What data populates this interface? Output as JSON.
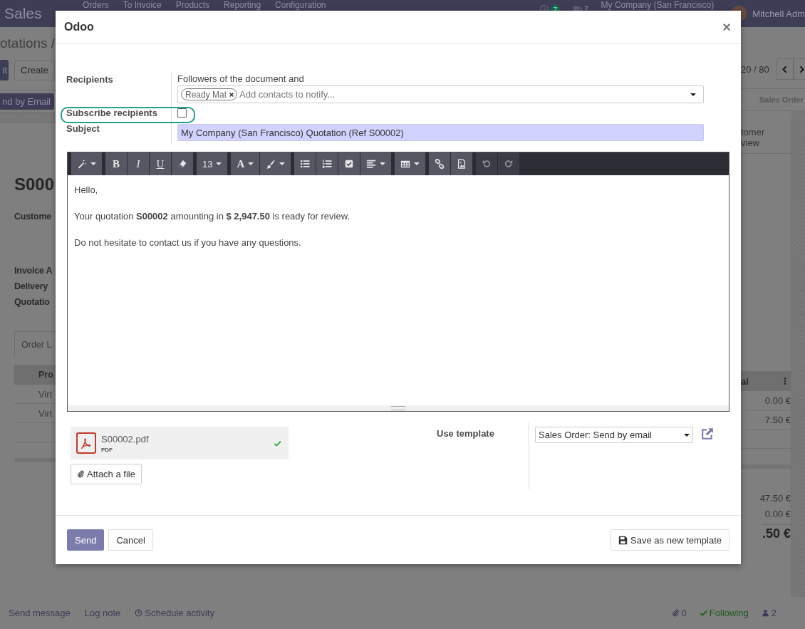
{
  "top_bar": {
    "app": "Sales",
    "menu": [
      "Orders",
      "To Invoice",
      "Products",
      "Reporting",
      "Configuration"
    ],
    "activity_count": "7",
    "message_count": "7",
    "company": "My Company (San Francisco)",
    "user": "Mitchell Adm"
  },
  "background": {
    "breadcrumb": "otations /",
    "buttons": [
      {
        "label": "it",
        "kind": "primary"
      },
      {
        "label": "Create",
        "kind": "secondary"
      }
    ],
    "action_button": "nd by Email",
    "pager": "20 / 80",
    "status": "Sales Order",
    "smart_button": [
      "tomer",
      "view"
    ],
    "record_name": "S000",
    "fields": [
      "Custome",
      "Invoice A",
      "Delivery",
      "Quotatio"
    ],
    "tab": "Order L",
    "table": {
      "columns": [
        "Pro",
        "al"
      ],
      "rows": [
        [
          "Virt",
          "0.00 €"
        ],
        [
          "Virt",
          "7.50 €"
        ]
      ]
    },
    "totals": [
      {
        "value": "47.50 €",
        "kind": "line"
      },
      {
        "value": "0.00 €",
        "kind": "line"
      },
      {
        "value": ".50 €",
        "kind": "total"
      }
    ]
  },
  "chatter": {
    "actions": [
      {
        "label": "Send message",
        "kind": "plain"
      },
      {
        "label": "Log note",
        "kind": "plain"
      },
      {
        "label": "Schedule activity",
        "kind": "clock"
      }
    ],
    "attachments": "0",
    "following": "Following",
    "followers": "2"
  },
  "dialog": {
    "title": "Odoo",
    "close": "×",
    "recipients": {
      "label": "Recipients",
      "note": "Followers of the document and",
      "tags": [
        "Ready Mat"
      ],
      "placeholder": "Add contacts to notify..."
    },
    "subscribe": {
      "label": "Subscribe recipients",
      "checked": false,
      "highlighted": true
    },
    "subject": {
      "label": "Subject",
      "value": "My Company (San Francisco) Quotation (Ref S00002)"
    },
    "toolbar": [
      [
        {
          "kind": "wand",
          "dropdown": true
        }
      ],
      [
        {
          "kind": "bold",
          "label": "B"
        },
        {
          "kind": "italic",
          "label": "I"
        },
        {
          "kind": "underline",
          "label": "U"
        },
        {
          "kind": "eraser"
        }
      ],
      [
        {
          "kind": "text",
          "label": "13",
          "dropdown": true
        }
      ],
      [
        {
          "kind": "bold",
          "label": "A",
          "dropdown": true
        },
        {
          "kind": "brush",
          "dropdown": true
        }
      ],
      [
        {
          "kind": "bullets"
        },
        {
          "kind": "numbers"
        },
        {
          "kind": "checklist"
        },
        {
          "kind": "align",
          "dropdown": true
        }
      ],
      [
        {
          "kind": "table",
          "dropdown": true
        }
      ],
      [
        {
          "kind": "link"
        },
        {
          "kind": "image"
        }
      ],
      [
        {
          "kind": "undo",
          "disabled": true
        },
        {
          "kind": "redo",
          "disabled": true
        }
      ]
    ],
    "body": [
      "Hello,",
      "Your quotation **S00002** amounting in **$ 2,947.50** is ready for review.",
      "Do not hesitate to contact us if you have any questions."
    ],
    "attachment": {
      "name": "S00002.pdf",
      "type": "PDF",
      "uploaded": true
    },
    "attach_button": "Attach a file",
    "template": {
      "label": "Use template",
      "value": "Sales Order: Send by email"
    },
    "buttons": [
      {
        "label": "Send",
        "kind": "primary"
      },
      {
        "label": "Cancel",
        "kind": "secondary"
      }
    ],
    "save_template": "Save as new template"
  }
}
